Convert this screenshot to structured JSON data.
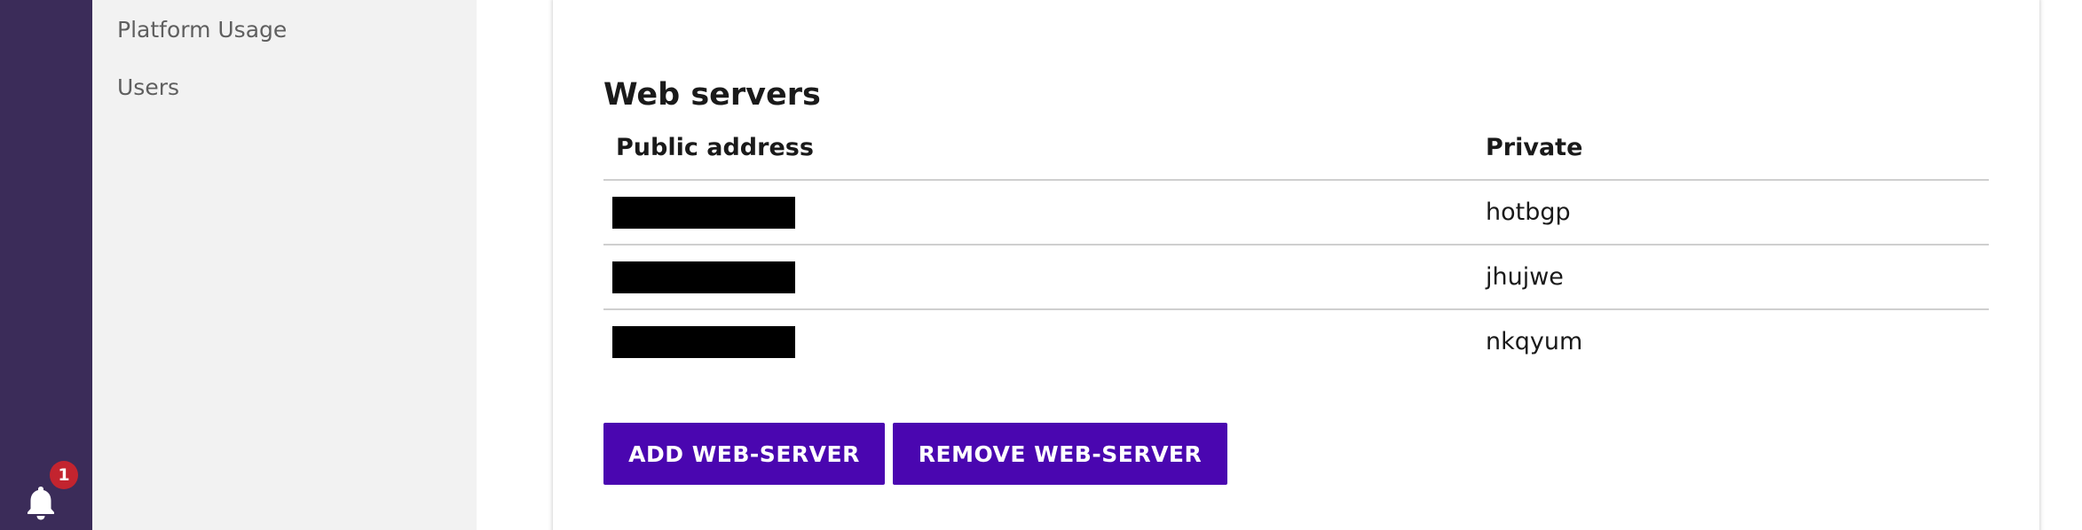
{
  "notifications": {
    "icon": "bell-icon",
    "count": "1",
    "badge_color": "#c3242f"
  },
  "sidebar": {
    "rail_color": "#3b2c59",
    "items": [
      {
        "label": "Platform Usage"
      },
      {
        "label": "Users"
      }
    ]
  },
  "web_servers": {
    "title": "Web servers",
    "columns": [
      "Public address",
      "Private"
    ],
    "rows": [
      {
        "public_address": "",
        "public_address_redacted": true,
        "private": "hotbgp"
      },
      {
        "public_address": "",
        "public_address_redacted": true,
        "private": "jhujwe"
      },
      {
        "public_address": "",
        "public_address_redacted": true,
        "private": "nkqyum"
      }
    ],
    "actions": {
      "add_label": "ADD WEB-SERVER",
      "remove_label": "REMOVE WEB-SERVER",
      "button_color": "#4a06b0"
    }
  }
}
